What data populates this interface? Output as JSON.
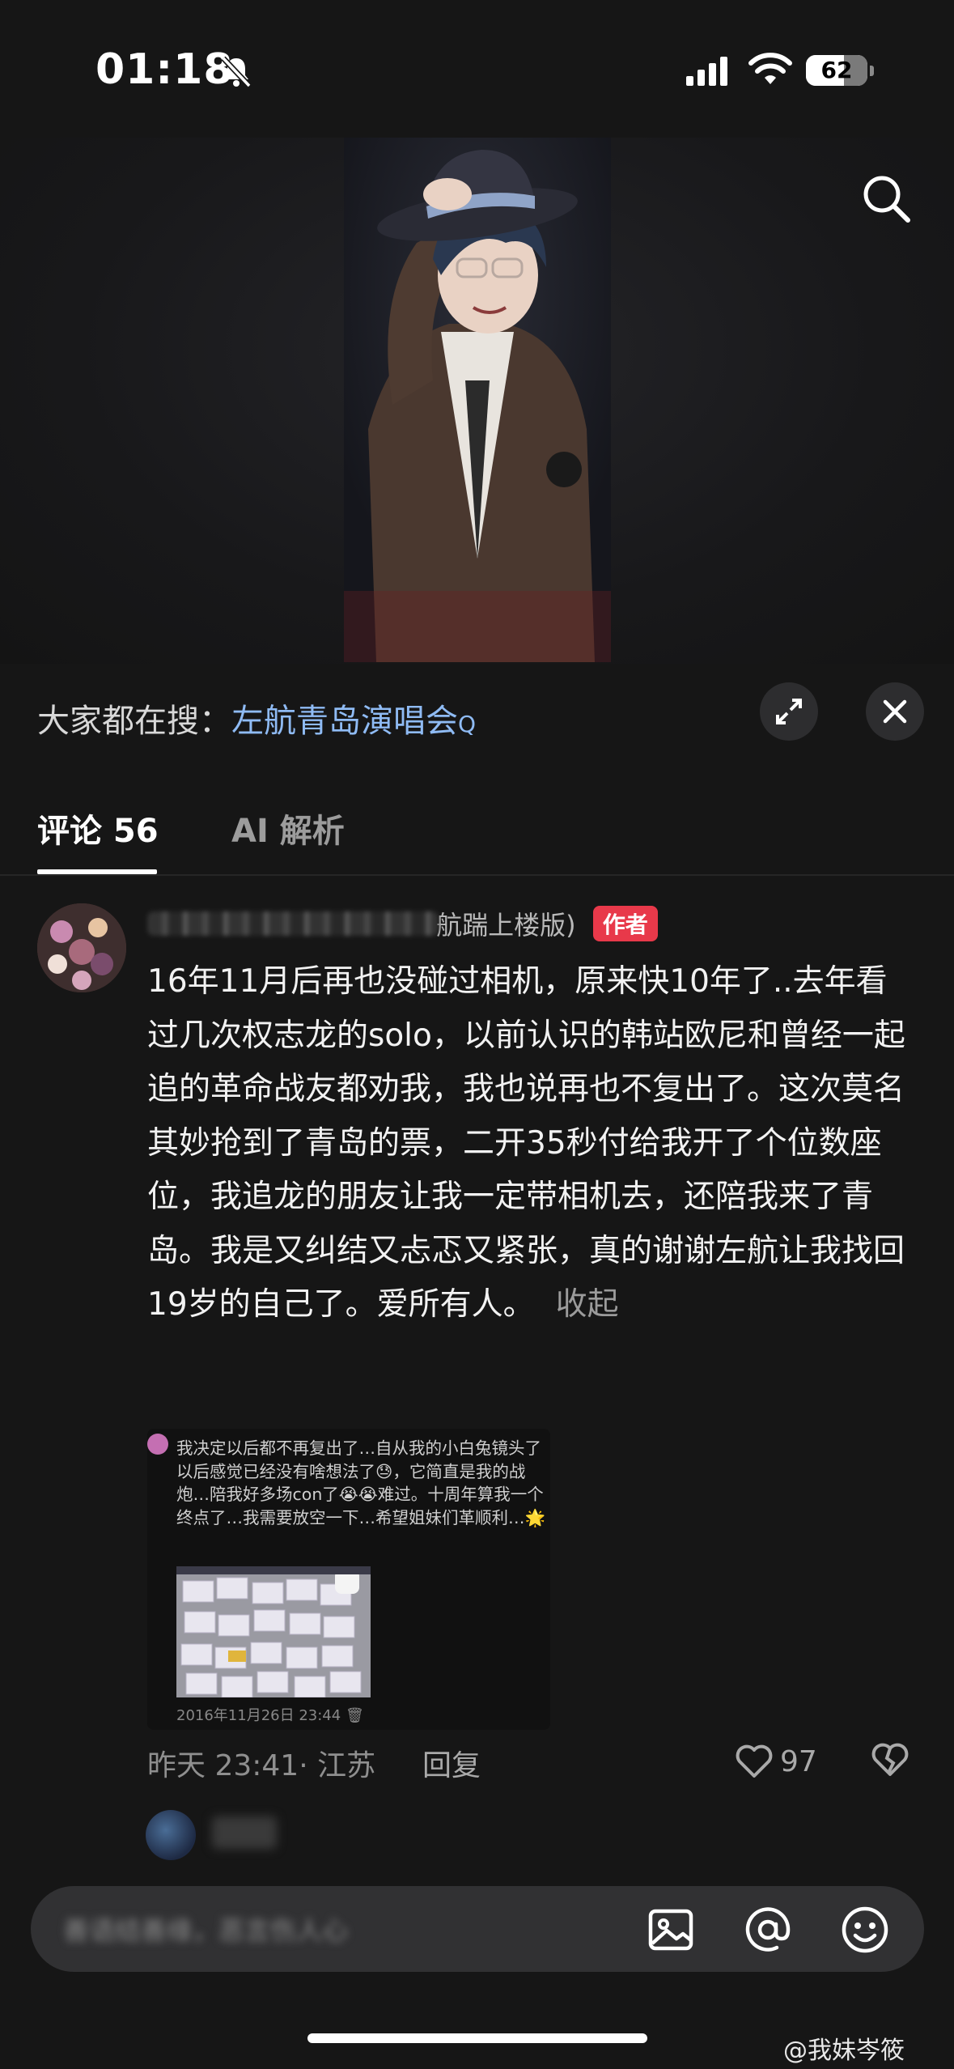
{
  "status_bar": {
    "time": "01:18",
    "battery": "62",
    "battery_level_percent": 62
  },
  "hot_search": {
    "prefix": "大家都在搜：",
    "keyword": "左航青岛演唱会",
    "query_glyph": "Q"
  },
  "tabs": [
    {
      "label": "评论 56",
      "active": true
    },
    {
      "label": "AI 解析",
      "active": false
    }
  ],
  "comment": {
    "author_visible": "航踹上楼版)",
    "author_badge": "作者",
    "text": "16年11月后再也没碰过相机，原来快10年了..去年看过几次权志龙的solo，以前认识的韩站欧尼和曾经一起追的革命战友都劝我，我也说再也不复出了。这次莫名其妙抢到了青岛的票，二开35秒付给我开了个位数座位，我追龙的朋友让我一定带相机去，还陪我来了青岛。我是又纠结又忐忑又紧张，真的谢谢左航让我找回19岁的自己了。爱所有人。",
    "collapse_label": "收起",
    "embedded_post": {
      "text": "我决定以后都不再复出了…自从我的小白兔镜头了以后感觉已经没有啥想法了😓，它简直是我的战炮…陪我好多场con了😭😭难过。十周年算我一个终点了…我需要放空一下…希望姐妹们革顺利…🌟",
      "date": "2016年11月26日 23:44"
    },
    "time_location": "昨天 23:41· 江苏",
    "reply_label": "回复",
    "likes": "97"
  },
  "input_bar": {
    "placeholder": "善语结善缘，恶言伤人心"
  },
  "watermark": "@我妹岑筱",
  "colors": {
    "accent_link": "#8fbbf4",
    "author_badge": "#e8394a",
    "background": "#161616"
  }
}
